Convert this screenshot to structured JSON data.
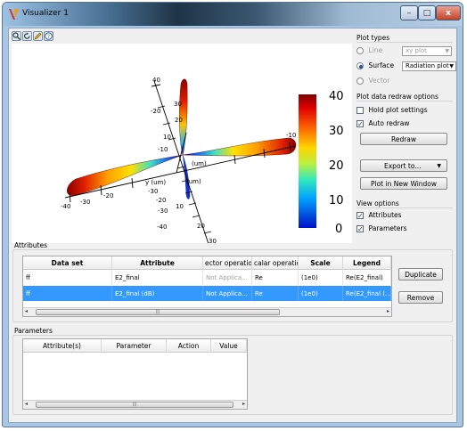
{
  "window": {
    "title": "Visualizer 1",
    "minimize": "–",
    "maximize": "□",
    "close": "x"
  },
  "plot": {
    "colorbar_ticks": [
      "40",
      "30",
      "20",
      "10",
      "0"
    ],
    "axis_labels": {
      "x": "(um)",
      "y": "y (um)",
      "z": "(um)"
    },
    "ticks_vertical": [
      "40",
      "30",
      "20",
      "10",
      "-10",
      "-20",
      "-30",
      "-40"
    ],
    "ticks_left": [
      "-20",
      "-30",
      "-40"
    ],
    "ticks_lower": [
      "-10",
      "-20",
      "-30",
      "-40"
    ],
    "ticks_low": [
      "10",
      "20",
      "30"
    ],
    "tick_extra_right": "-10"
  },
  "plot_types": {
    "title": "Plot types",
    "line_label": "Line",
    "line_combo": "xy plot",
    "surface_label": "Surface",
    "surface_combo": "Radiation plot",
    "vector_label": "Vector"
  },
  "redraw_options": {
    "title": "Plot data redraw options",
    "hold_label": "Hold plot settings",
    "auto_label": "Auto redraw",
    "redraw_button": "Redraw"
  },
  "export_button": "Export to...",
  "new_window_button": "Plot in New Window",
  "view_options": {
    "title": "View options",
    "attributes_label": "Attributes",
    "parameters_label": "Parameters"
  },
  "attributes": {
    "title": "Attributes",
    "columns": [
      "Data set",
      "Attribute",
      "ector operatio",
      "calar operatio",
      "Scale",
      "Legend"
    ],
    "rows": [
      [
        "ff",
        "E2_final",
        "Not Applica...",
        "Re",
        "(1e0)",
        "Re(E2_final)"
      ],
      [
        "ff",
        "E2_final (dB)",
        "Not Applica...",
        "Re",
        "(1e0)",
        "Re(E2_final (..."
      ]
    ],
    "duplicate_button": "Duplicate",
    "remove_button": "Remove"
  },
  "parameters": {
    "title": "Parameters",
    "columns": [
      "Attribute(s)",
      "Parameter",
      "Action",
      "Value"
    ]
  },
  "colors": {
    "selection": "#3399ff",
    "titlebar_dark": "#1f3447",
    "window_frame": "#a9c6e3"
  }
}
